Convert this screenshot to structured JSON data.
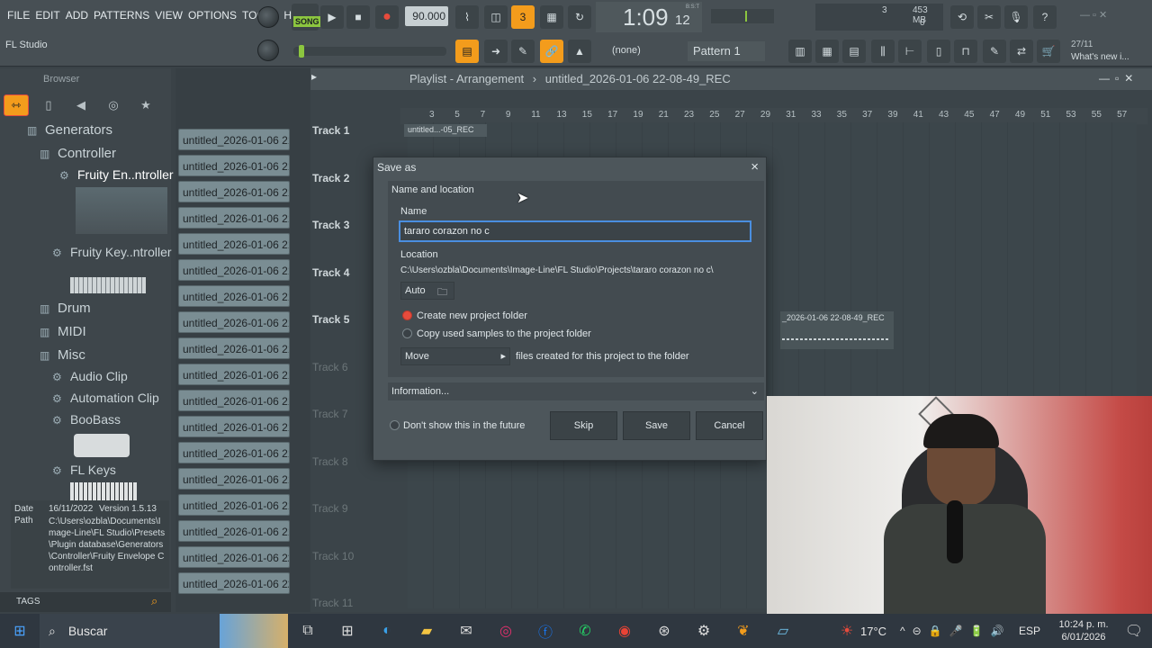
{
  "menu": [
    "FILE",
    "EDIT",
    "ADD",
    "PATTERNS",
    "VIEW",
    "OPTIONS",
    "TOOLS",
    "HELP"
  ],
  "topbar": {
    "song_label": "SONG",
    "tempo": "90.000",
    "time_main": "1:09",
    "time_sub": "12",
    "time_unit": "B:S:T",
    "cpu_value": "3",
    "mem_value": "453 MB",
    "poly_value": "0",
    "hint_title": "FL Studio",
    "snap_label": "(none)",
    "pattern_label": "Pattern 1",
    "news_date": "27/11",
    "news_text": "What's new i..."
  },
  "browser": {
    "title": "Browser",
    "tree": {
      "generators": "Generators",
      "controller": "Controller",
      "fruity_env": "Fruity En..ntroller",
      "fruity_key": "Fruity Key..ntroller",
      "drum": "Drum",
      "midi": "MIDI",
      "misc": "Misc",
      "audio_clip": "Audio Clip",
      "automation_clip": "Automation Clip",
      "boobass": "BooBass",
      "fl_keys": "FL Keys"
    },
    "info": {
      "date_label": "Date",
      "path_label": "Path",
      "date_value": "16/11/2022",
      "version": "Version 1.5.13",
      "path_value": "C:\\Users\\ozbla\\Documents\\Image-Line\\FL Studio\\Presets\\Plugin database\\Generators\\Controller\\Fruity Envelope Controller.fst"
    },
    "tags_label": "TAGS"
  },
  "channels": [
    "untitled_2026-01-06 21-...",
    "untitled_2026-01-06 21-...",
    "untitled_2026-01-06 21-...",
    "untitled_2026-01-06 21-...",
    "untitled_2026-01-06 21-...",
    "untitled_2026-01-06 21-...",
    "untitled_2026-01-06 21-...",
    "untitled_2026-01-06 21-...",
    "untitled_2026-01-06 21-...",
    "untitled_2026-01-06 21-...",
    "untitled_2026-01-06 21-...",
    "untitled_2026-01-06 21-...",
    "untitled_2026-01-06 21-...",
    "untitled_2026-01-06 21-...",
    "untitled_2026-01-06 21-...",
    "untitled_2026-01-06 21-...",
    "untitled_2026-01-06 22-...",
    "untitled_2026-01-06 22-..."
  ],
  "playlist": {
    "title": "Playlist - Arrangement",
    "project": "untitled_2026-01-06 22-08-49_REC",
    "ruler": [
      "3",
      "5",
      "7",
      "9",
      "11",
      "13",
      "15",
      "17",
      "19",
      "21",
      "23",
      "25",
      "27",
      "29",
      "31",
      "33",
      "35",
      "37",
      "39",
      "41",
      "43",
      "45",
      "47",
      "49",
      "51",
      "53",
      "55",
      "57"
    ],
    "tracks": [
      "Track 1",
      "Track 2",
      "Track 3",
      "Track 4",
      "Track 5",
      "Track 6",
      "Track 7",
      "Track 8",
      "Track 9",
      "Track 10",
      "Track 11"
    ],
    "clip1": "untitled...-05_REC",
    "clip2": "_2026-01-06 22-08-49_REC"
  },
  "dialog": {
    "title": "Save as",
    "section": "Name and location",
    "name_label": "Name",
    "name_value": "tararo corazon no c",
    "location_label": "Location",
    "location_value": "C:\\Users\\ozbla\\Documents\\Image-Line\\FL Studio\\Projects\\tararo corazon no c\\",
    "auto_label": "Auto",
    "opt_create": "Create new project folder",
    "opt_copy": "Copy used samples to the project folder",
    "move_label": "Move",
    "move_desc": "files created for this project to the folder",
    "information": "Information...",
    "dont_show": "Don't show this in the future",
    "skip": "Skip",
    "save": "Save",
    "cancel": "Cancel"
  },
  "taskbar": {
    "search": "Buscar",
    "temp": "17°C",
    "lang": "ESP",
    "time": "10:24 p. m.",
    "date": "6/01/2026"
  }
}
